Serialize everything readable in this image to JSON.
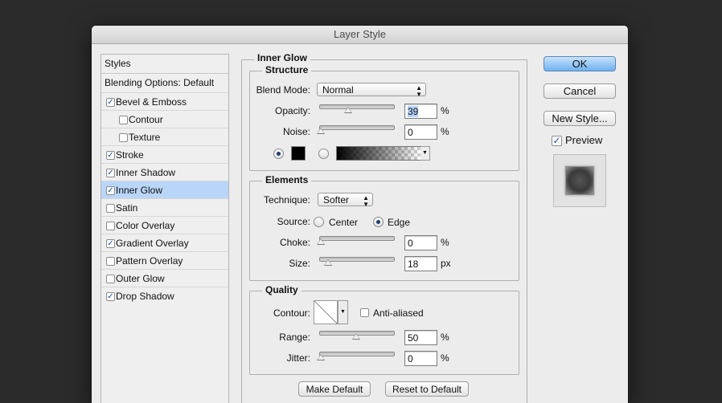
{
  "window": {
    "title": "Layer Style"
  },
  "styles_panel": {
    "header": "Styles",
    "blending_options": "Blending Options: Default",
    "items": [
      {
        "label": "Bevel & Emboss",
        "checked": true,
        "indent": false,
        "selected": false
      },
      {
        "label": "Contour",
        "checked": false,
        "indent": true,
        "selected": false
      },
      {
        "label": "Texture",
        "checked": false,
        "indent": true,
        "selected": false
      },
      {
        "label": "Stroke",
        "checked": true,
        "indent": false,
        "selected": false
      },
      {
        "label": "Inner Shadow",
        "checked": true,
        "indent": false,
        "selected": false
      },
      {
        "label": "Inner Glow",
        "checked": true,
        "indent": false,
        "selected": true
      },
      {
        "label": "Satin",
        "checked": false,
        "indent": false,
        "selected": false
      },
      {
        "label": "Color Overlay",
        "checked": false,
        "indent": false,
        "selected": false
      },
      {
        "label": "Gradient Overlay",
        "checked": true,
        "indent": false,
        "selected": false
      },
      {
        "label": "Pattern Overlay",
        "checked": false,
        "indent": false,
        "selected": false
      },
      {
        "label": "Outer Glow",
        "checked": false,
        "indent": false,
        "selected": false
      },
      {
        "label": "Drop Shadow",
        "checked": true,
        "indent": false,
        "selected": false
      }
    ]
  },
  "inner_glow": {
    "title": "Inner Glow",
    "structure": {
      "title": "Structure",
      "blend_mode_label": "Blend Mode:",
      "blend_mode_value": "Normal",
      "opacity_label": "Opacity:",
      "opacity_value": "39",
      "opacity_unit": "%",
      "opacity_level": 0.39,
      "noise_label": "Noise:",
      "noise_value": "0",
      "noise_unit": "%",
      "noise_level": 0,
      "color_mode": "solid",
      "swatch_color": "#000000"
    },
    "elements": {
      "title": "Elements",
      "technique_label": "Technique:",
      "technique_value": "Softer",
      "source_label": "Source:",
      "source_center": "Center",
      "source_edge": "Edge",
      "source_selected": "edge",
      "choke_label": "Choke:",
      "choke_value": "0",
      "choke_unit": "%",
      "choke_level": 0,
      "size_label": "Size:",
      "size_value": "18",
      "size_unit": "px",
      "size_level": 0.1
    },
    "quality": {
      "title": "Quality",
      "contour_label": "Contour:",
      "anti_aliased_label": "Anti-aliased",
      "anti_aliased_checked": false,
      "range_label": "Range:",
      "range_value": "50",
      "range_unit": "%",
      "range_level": 0.5,
      "jitter_label": "Jitter:",
      "jitter_value": "0",
      "jitter_unit": "%",
      "jitter_level": 0
    },
    "make_default_label": "Make Default",
    "reset_default_label": "Reset to Default"
  },
  "actions": {
    "ok_label": "OK",
    "cancel_label": "Cancel",
    "new_style_label": "New Style...",
    "preview_label": "Preview",
    "preview_checked": true
  }
}
